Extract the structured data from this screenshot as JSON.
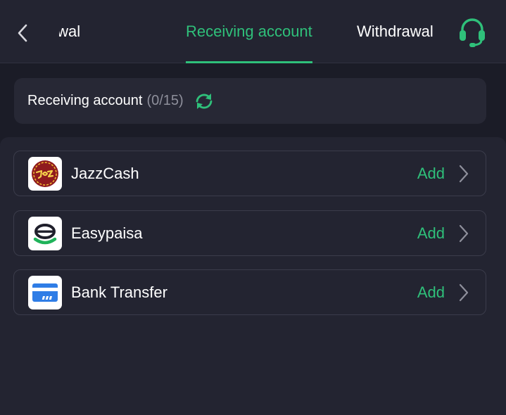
{
  "header": {
    "tabs": [
      {
        "label": "t withdrawal",
        "state": "partially-visible"
      },
      {
        "label": "Receiving account",
        "state": "active"
      },
      {
        "label": "Withdrawal",
        "state": "inactive"
      }
    ],
    "back_icon": "chevron-left-icon",
    "support_icon": "headset-icon"
  },
  "summary": {
    "title": "Receiving account",
    "count": "(0/15)",
    "refresh_icon": "refresh-icon"
  },
  "accounts": [
    {
      "name": "JazzCash",
      "action": "Add",
      "icon": "jazzcash-logo"
    },
    {
      "name": "Easypaisa",
      "action": "Add",
      "icon": "easypaisa-logo"
    },
    {
      "name": "Bank Transfer",
      "action": "Add",
      "icon": "bank-card-icon"
    }
  ],
  "colors": {
    "accent": "#2fc07a",
    "background": "#1b1c27",
    "panel": "#232431",
    "card": "#272835",
    "muted_text": "#8e8f9b"
  }
}
